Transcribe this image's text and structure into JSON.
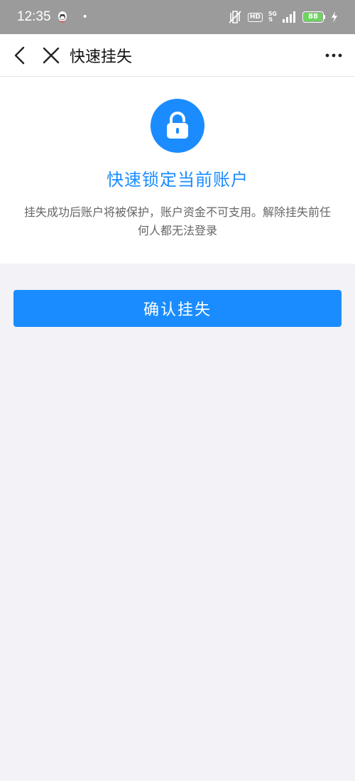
{
  "status_bar": {
    "time": "12:35",
    "network": "5G",
    "hd": "HD",
    "battery": "88",
    "colors": {
      "bg": "#9b9b9b",
      "battery_fill": "#6dd45e"
    }
  },
  "nav": {
    "title": "快速挂失",
    "back_icon": "chevron-left-icon",
    "close_icon": "close-icon",
    "more_icon": "more-dots-icon"
  },
  "hero": {
    "icon": "lock-icon",
    "title": "快速锁定当前账户",
    "description": "挂失成功后账户将被保护，账户资金不可支用。解除挂失前任何人都无法登录"
  },
  "actions": {
    "confirm_label": "确认挂失"
  },
  "colors": {
    "accent": "#1a8cff",
    "page_bg": "#f2f2f7"
  }
}
